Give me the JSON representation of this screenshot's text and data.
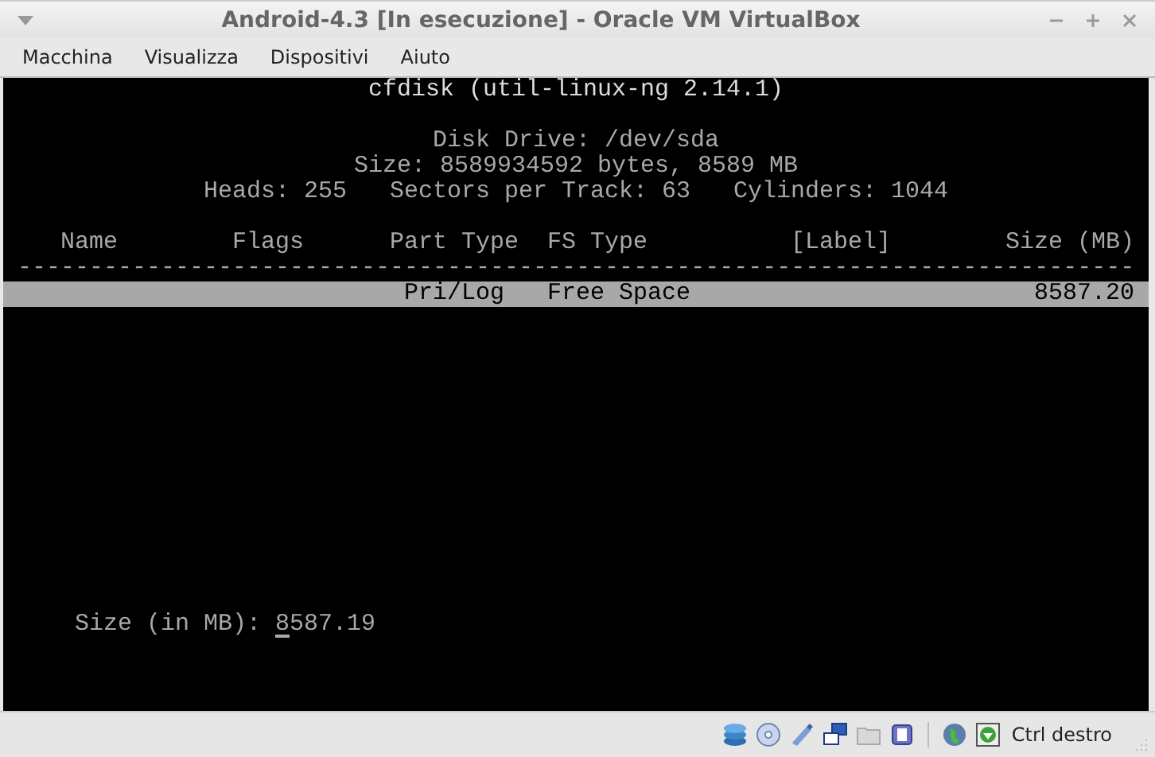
{
  "window": {
    "title": "Android-4.3 [In esecuzione] - Oracle VM VirtualBox"
  },
  "menu": [
    "Macchina",
    "Visualizza",
    "Dispositivi",
    "Aiuto"
  ],
  "terminal": {
    "title": "cfdisk (util-linux-ng 2.14.1)",
    "disk_info": [
      "Disk Drive: /dev/sda",
      "Size: 8589934592 bytes, 8589 MB",
      "Heads: 255   Sectors per Track: 63   Cylinders: 1044"
    ],
    "columns": [
      "Name",
      "Flags",
      "Part Type",
      "FS Type",
      "[Label]",
      "Size (MB)"
    ],
    "separator": "------------------------------------------------------------------------------",
    "rows": [
      {
        "part_type": "Pri/Log",
        "fs_type": "Free Space",
        "size": "8587.20",
        "selected": true
      }
    ],
    "prompt": {
      "label": "Size (in MB):",
      "value": "8587.19"
    }
  },
  "status_bar": {
    "host_key": "Ctrl destro"
  }
}
